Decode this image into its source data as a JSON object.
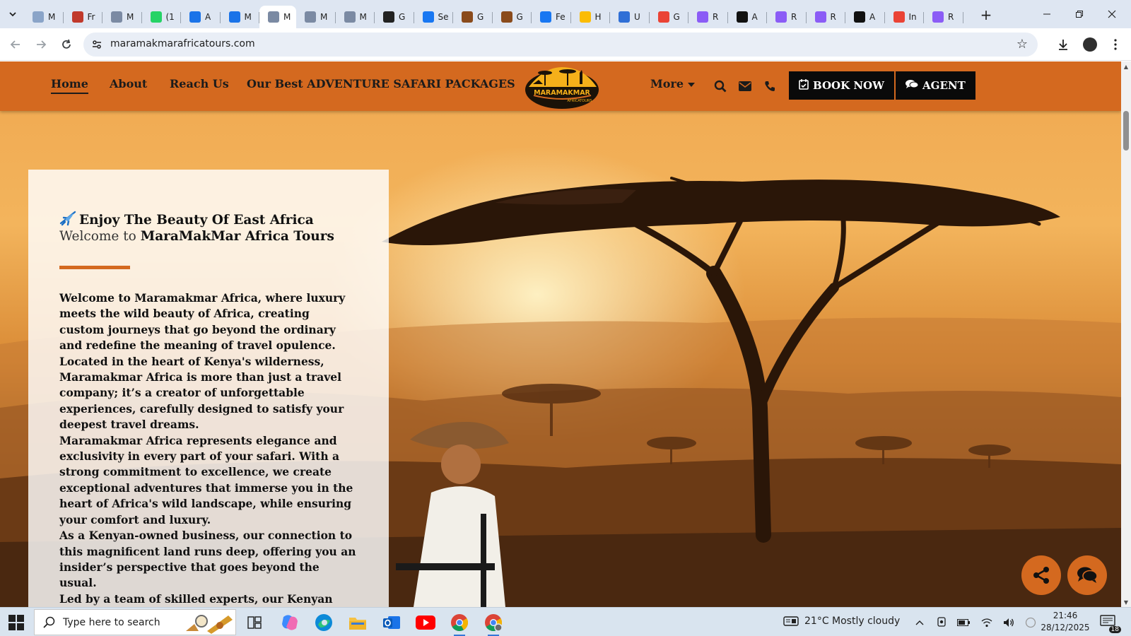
{
  "browser": {
    "tabs": [
      {
        "label": "M",
        "icon": "cloud-icon",
        "color": "#8aa4c8"
      },
      {
        "label": "Fr",
        "icon": "shield-flag-icon",
        "color": "#c0392b"
      },
      {
        "label": "M",
        "icon": "mail-icon",
        "color": "#7b8aa3"
      },
      {
        "label": "(1",
        "icon": "whatsapp-icon",
        "color": "#25d366"
      },
      {
        "label": "A",
        "icon": "doc-icon",
        "color": "#1a73e8"
      },
      {
        "label": "M",
        "icon": "doc-icon",
        "color": "#1a73e8"
      },
      {
        "label": "M",
        "icon": "mail-icon",
        "color": "#7b8aa3",
        "active": true
      },
      {
        "label": "M",
        "icon": "mail-icon",
        "color": "#7b8aa3"
      },
      {
        "label": "M",
        "icon": "mail-icon",
        "color": "#7b8aa3"
      },
      {
        "label": "G",
        "icon": "ai-icon",
        "color": "#222222"
      },
      {
        "label": "Se",
        "icon": "facebook-icon",
        "color": "#1877f2"
      },
      {
        "label": "G",
        "icon": "safari-icon",
        "color": "#8a4b1c"
      },
      {
        "label": "G",
        "icon": "safari-icon",
        "color": "#8a4b1c"
      },
      {
        "label": "Fe",
        "icon": "facebook-icon",
        "color": "#1877f2"
      },
      {
        "label": "H",
        "icon": "ads-icon",
        "color": "#fbbc04"
      },
      {
        "label": "U",
        "icon": "chart-icon",
        "color": "#2f6fd6"
      },
      {
        "label": "G",
        "icon": "google-icon",
        "color": "#ea4335"
      },
      {
        "label": "R",
        "icon": "seo-icon",
        "color": "#8b5cf6"
      },
      {
        "label": "A",
        "icon": "app-icon",
        "color": "#111111"
      },
      {
        "label": "R",
        "icon": "seo-icon",
        "color": "#8b5cf6"
      },
      {
        "label": "R",
        "icon": "seo-icon",
        "color": "#8b5cf6"
      },
      {
        "label": "A",
        "icon": "app-icon",
        "color": "#111111"
      },
      {
        "label": "In",
        "icon": "gmail-icon",
        "color": "#ea4335"
      },
      {
        "label": "R",
        "icon": "seo-icon",
        "color": "#8b5cf6"
      }
    ],
    "url": "maramakmarafricatours.com"
  },
  "site": {
    "nav": {
      "home": "Home",
      "about": "About",
      "reach": "Reach Us",
      "packages": "Our Best ADVENTURE SAFARI PACKAGES",
      "more": "More",
      "book": "BOOK NOW",
      "agent": "AGENT"
    },
    "logo_text": "MARAMAKMAR",
    "logo_sub": "AFRICATOURS",
    "brand_color": "#d4691f",
    "hero": {
      "eyebrow": "Enjoy The Beauty Of East Africa",
      "welcome_prefix": "Welcome to",
      "welcome_name": "MaraMakMar Africa Tours",
      "paragraphs": [
        "Welcome to Maramakmar Africa, where luxury meets the wild beauty of Africa, creating custom journeys that go beyond the ordinary and redefine the meaning of travel opulence.",
        "Located in the heart of Kenya's wilderness, Maramakmar Africa is more than just a travel company; it’s a creator of unforgettable experiences, carefully designed to satisfy your deepest travel dreams.",
        "Maramakmar Africa represents elegance and exclusivity in every part of your safari. With a strong commitment to excellence, we create exceptional adventures that immerse you in the heart of Africa's wild landscape, while ensuring your comfort and luxury.",
        "As a Kenyan-owned business, our connection to this magnificent land runs deep, offering you an insider’s perspective that goes beyond the usual.",
        "Led by a team of skilled experts, our Kenyan safari guides are not just knowledgeable about the wild;"
      ]
    }
  },
  "taskbar": {
    "search_placeholder": "Type here to search",
    "weather": "21°C  Mostly cloudy",
    "time": "21:46",
    "date": "28/12/2025",
    "notification_count": "18"
  }
}
